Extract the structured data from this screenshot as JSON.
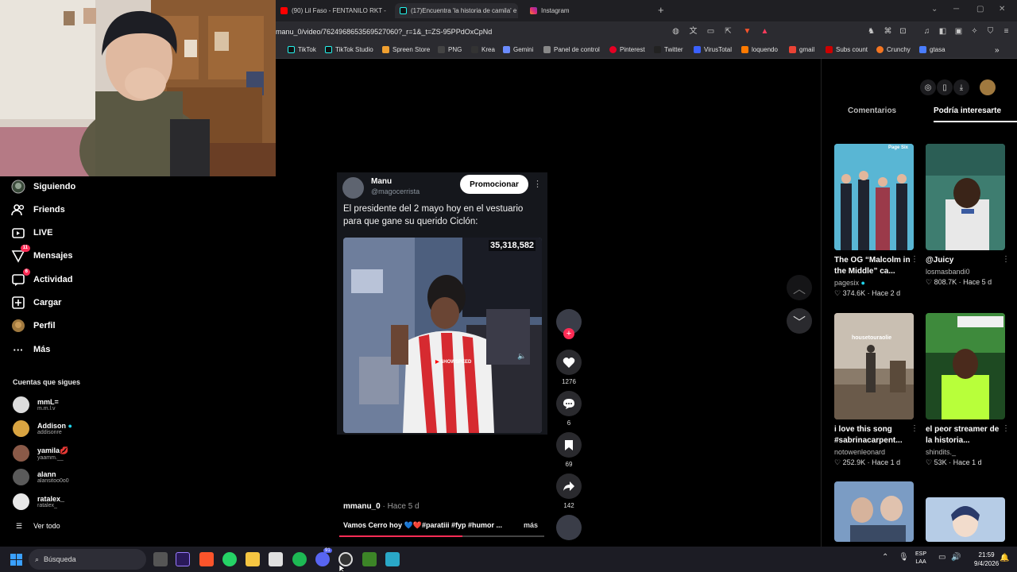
{
  "browser": {
    "tabs": [
      {
        "label": "(90) Lil Faso - FENTANILO RKT - YouT",
        "icon": "youtube-icon",
        "color": "#ff0000"
      },
      {
        "label": "(17)Encuentra 'la historia de camila' e",
        "icon": "tiktok-icon",
        "color": "#000000"
      },
      {
        "label": "Instagram",
        "icon": "instagram-icon",
        "color": "#e1306c"
      }
    ],
    "url": "manu_0/video/7624968653569527060?_r=1&_t=ZS-95PPdOxCpNd",
    "bookmarks": [
      {
        "label": "TikTok",
        "color": "#111111"
      },
      {
        "label": "TikTok Studio",
        "color": "#111111"
      },
      {
        "label": "Spreen Store",
        "color": "#f0a030"
      },
      {
        "label": "PNG",
        "color": "#444444"
      },
      {
        "label": "Krea",
        "color": "#333333"
      },
      {
        "label": "Gemini",
        "color": "#6b8cff"
      },
      {
        "label": "Panel de control",
        "color": "#888888"
      },
      {
        "label": "Pinterest",
        "color": "#e60023"
      },
      {
        "label": "Twitter",
        "color": "#222222"
      },
      {
        "label": "VirusTotal",
        "color": "#3b61ff"
      },
      {
        "label": "loquendo",
        "color": "#ff7a00"
      },
      {
        "label": "gmail",
        "color": "#ea4335"
      },
      {
        "label": "Subs count",
        "color": "#cc0000"
      },
      {
        "label": "Crunchy",
        "color": "#f47521"
      },
      {
        "label": "gtasa",
        "color": "#4a7dff"
      }
    ]
  },
  "sidebar": {
    "items": [
      {
        "label": "Siguiendo",
        "icon": "following-icon",
        "badge": ""
      },
      {
        "label": "Friends",
        "icon": "friends-icon",
        "badge": ""
      },
      {
        "label": "LIVE",
        "icon": "live-icon",
        "badge": ""
      },
      {
        "label": "Mensajes",
        "icon": "messages-icon",
        "badge": "11"
      },
      {
        "label": "Actividad",
        "icon": "activity-icon",
        "badge": "6"
      },
      {
        "label": "Cargar",
        "icon": "upload-icon",
        "badge": ""
      },
      {
        "label": "Perfil",
        "icon": "profile-icon",
        "badge": ""
      },
      {
        "label": "Más",
        "icon": "more-icon",
        "badge": ""
      }
    ],
    "following_title": "Cuentas que sigues",
    "accounts": [
      {
        "name": "mmL=",
        "handle": "m.m.l.v",
        "color": "#dcdcdc"
      },
      {
        "name": "Addison",
        "handle": "addisonre",
        "color": "#d9a441"
      },
      {
        "name": "yamila💋",
        "handle": "yaamm.__",
        "color": "#8a5a48"
      },
      {
        "name": "alann",
        "handle": "alansitoo0o0",
        "color": "#5a5a5a"
      },
      {
        "name": "ratalex_",
        "handle": "ratalex_",
        "color": "#e8e8e8"
      }
    ],
    "see_all": "Ver todo"
  },
  "video": {
    "author_name": "Manu",
    "author_handle": "@magocerrista",
    "promote_label": "Promocionar",
    "tweet_text": "El presidente del 2 mayo hoy en el vestuario para que gane su querido Ciclón:",
    "view_count": "35,318,582",
    "watermark": "SHOWSPEED",
    "username": "mmanu_0",
    "posted": " · Hace 5 d",
    "caption": "Vamos Cerro hoy 💙❤️#paratiii #fyp #humor ...",
    "more_label": "más",
    "progress": 0.6
  },
  "actions": {
    "likes": "1276",
    "comments": "6",
    "saves": "69",
    "shares": "142"
  },
  "right_panel": {
    "tab_comments": "Comentarios",
    "tab_interest": "Podría interesarte",
    "tiles": [
      {
        "title": "The OG “Malcolm in the Middle” ca...",
        "author": "pagesix",
        "likes": "♡ 374.6K · Hace 2 d",
        "color": "#4aa8c8"
      },
      {
        "title": "@Juicy",
        "author": "losmasbandi0",
        "likes": "♡ 808.7K · Hace 5 d",
        "color": "#3d7a6a"
      },
      {
        "title": "i love this song #sabrinacarpent...",
        "author": "notowenleonard",
        "likes": "♡ 252.9K · Hace 1 d",
        "color": "#7a6a58"
      },
      {
        "title": "el peor streamer de la historia...",
        "author": "shindits._",
        "likes": "♡ 53K · Hace 1 d",
        "color": "#2f6a30"
      },
      {
        "title": "",
        "author": "",
        "likes": "",
        "color": "#6b8fb5"
      },
      {
        "title": "",
        "author": "",
        "likes": "",
        "color": "#a9c2e0"
      }
    ],
    "thumb_text_1": "Page Six",
    "thumb_text_3": "housetouraolie"
  },
  "taskbar": {
    "search_placeholder": "Búsqueda",
    "lang_top": "ESP",
    "lang_bottom": "LAA",
    "time": "21:59",
    "date": "9/4/2026",
    "discord_badge": "91"
  }
}
